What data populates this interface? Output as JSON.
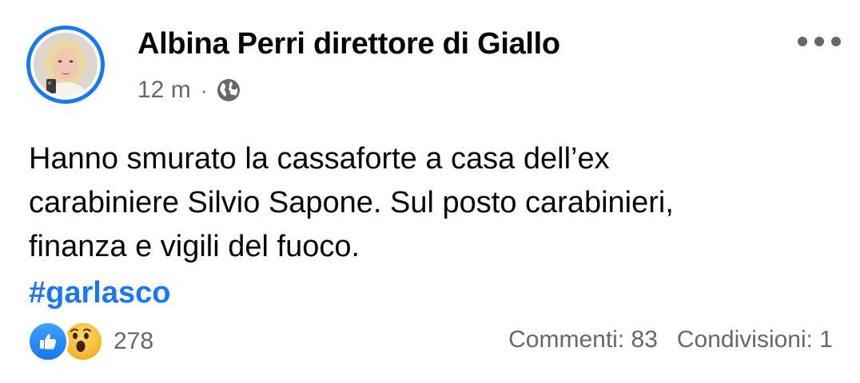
{
  "post": {
    "author": "Albina Perri direttore di Giallo",
    "timestamp": "12 m",
    "separator": "·",
    "privacy_icon": "globe-icon",
    "more_icon": "more-horizontal-icon",
    "body_lines": [
      "Hanno smurato la cassaforte a casa dell’ex",
      "carabiniere Silvio Sapone. Sul posto carabinieri,",
      "finanza e vigili del fuoco."
    ],
    "hashtag": "#garlasco"
  },
  "footer": {
    "reaction_icons": [
      "like-reaction-icon",
      "wow-reaction-icon"
    ],
    "reaction_count": "278",
    "comments": "Commenti: 83",
    "shares": "Condivisioni: 1"
  },
  "colors": {
    "accent": "#1877f2",
    "secondary_text": "#65676b",
    "primary_text": "#050505",
    "background": "#ffffff"
  }
}
